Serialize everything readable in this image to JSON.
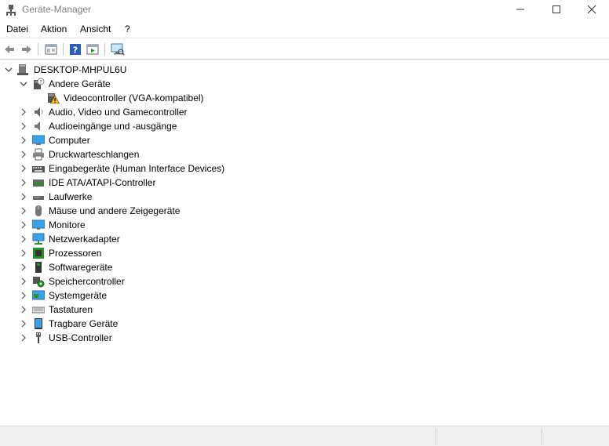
{
  "window": {
    "title": "Geräte-Manager"
  },
  "menu": [
    "Datei",
    "Aktion",
    "Ansicht",
    "?"
  ],
  "toolbar": {
    "icons": [
      "back-icon",
      "forward-icon",
      "properties-icon",
      "help-icon",
      "view-icon",
      "scan-hardware-icon"
    ]
  },
  "tree": {
    "root": "DESKTOP-MHPUL6U",
    "andere": "Andere Geräte",
    "andere_child": "Videocontroller (VGA-kompatibel)",
    "categories": [
      "Audio, Video und Gamecontroller",
      "Audioeingänge und -ausgänge",
      "Computer",
      "Druckwarteschlangen",
      "Eingabegeräte (Human Interface Devices)",
      "IDE ATA/ATAPI-Controller",
      "Laufwerke",
      "Mäuse und andere Zeigegeräte",
      "Monitore",
      "Netzwerkadapter",
      "Prozessoren",
      "Softwaregeräte",
      "Speichercontroller",
      "Systemgeräte",
      "Tastaturen",
      "Tragbare Geräte",
      "USB-Controller"
    ]
  },
  "colors": {
    "accent": "#1e6fd9",
    "warning": "#f5c211"
  }
}
